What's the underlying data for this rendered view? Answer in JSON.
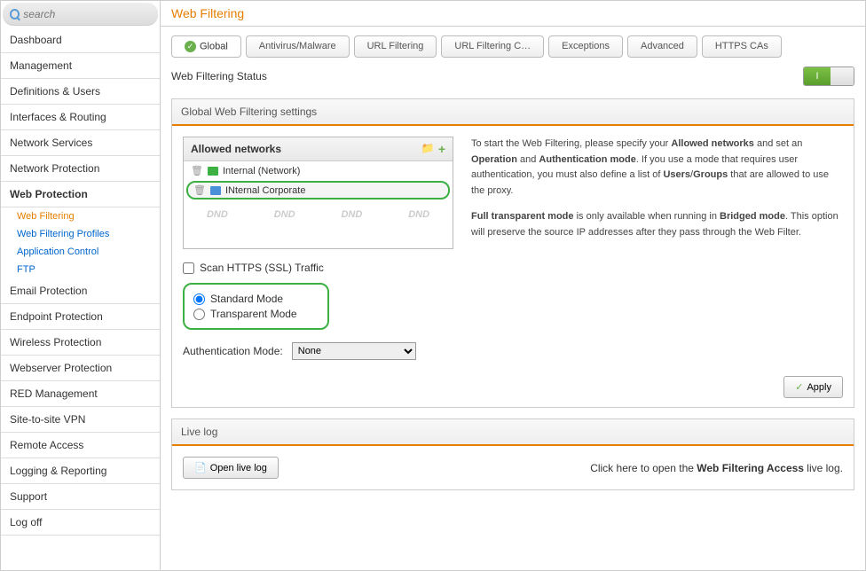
{
  "search": {
    "placeholder": "search"
  },
  "sidebar": {
    "items": [
      {
        "label": "Dashboard"
      },
      {
        "label": "Management"
      },
      {
        "label": "Definitions & Users"
      },
      {
        "label": "Interfaces & Routing"
      },
      {
        "label": "Network Services"
      },
      {
        "label": "Network Protection"
      },
      {
        "label": "Web Protection",
        "active": true
      },
      {
        "label": "Email Protection"
      },
      {
        "label": "Endpoint Protection"
      },
      {
        "label": "Wireless Protection"
      },
      {
        "label": "Webserver Protection"
      },
      {
        "label": "RED Management"
      },
      {
        "label": "Site-to-site VPN"
      },
      {
        "label": "Remote Access"
      },
      {
        "label": "Logging & Reporting"
      },
      {
        "label": "Support"
      },
      {
        "label": "Log off"
      }
    ],
    "subs": [
      {
        "label": "Web Filtering",
        "active": true
      },
      {
        "label": "Web Filtering Profiles"
      },
      {
        "label": "Application Control"
      },
      {
        "label": "FTP"
      }
    ]
  },
  "page": {
    "title": "Web Filtering"
  },
  "tabs": [
    {
      "label": "Global",
      "active": true,
      "checked": true
    },
    {
      "label": "Antivirus/Malware"
    },
    {
      "label": "URL Filtering"
    },
    {
      "label": "URL Filtering C…"
    },
    {
      "label": "Exceptions"
    },
    {
      "label": "Advanced"
    },
    {
      "label": "HTTPS CAs"
    }
  ],
  "status": {
    "label": "Web Filtering Status",
    "toggle": "I"
  },
  "settings": {
    "header": "Global Web Filtering settings",
    "allowed_networks_label": "Allowed networks",
    "networks": [
      {
        "name": "Internal (Network)",
        "icon": "green"
      },
      {
        "name": "INternal Corporate",
        "icon": "blue",
        "highlighted": true
      }
    ],
    "dnd": "DND",
    "scan_https_label": "Scan HTTPS (SSL) Traffic",
    "modes": [
      {
        "label": "Standard Mode",
        "checked": true
      },
      {
        "label": "Transparent Mode",
        "checked": false
      }
    ],
    "auth_mode_label": "Authentication Mode:",
    "auth_mode_value": "None",
    "help_p1a": "To start the Web Filtering, please specify your ",
    "help_p1b": "Allowed networks",
    "help_p1c": " and set an ",
    "help_p1d": "Operation",
    "help_p1e": " and ",
    "help_p1f": "Authentication mode",
    "help_p1g": ". If you use a mode that requires user authentication, you must also define a list of ",
    "help_p1h": "Users",
    "help_p1i": "/",
    "help_p1j": "Groups",
    "help_p1k": " that are allowed to use the proxy.",
    "help_p2a": "Full transparent mode",
    "help_p2b": " is only available when running in ",
    "help_p2c": "Bridged mode",
    "help_p2d": ". This option will preserve the source IP addresses after they pass through the Web Filter.",
    "apply_label": "Apply"
  },
  "livelog": {
    "header": "Live log",
    "button": "Open live log",
    "text_a": "Click here to open the ",
    "text_b": "Web Filtering Access",
    "text_c": " live log."
  }
}
